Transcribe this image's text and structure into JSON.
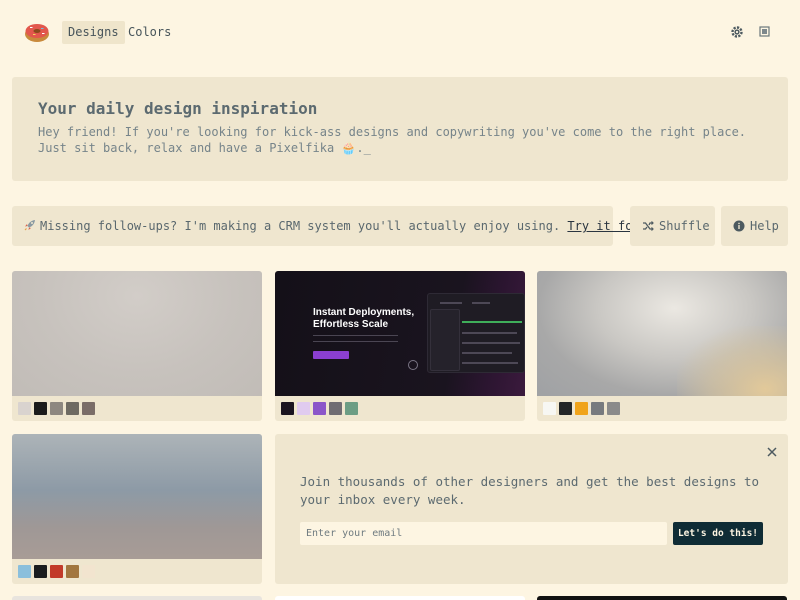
{
  "header": {
    "nav": [
      {
        "label": "Designs",
        "active": true
      },
      {
        "label": "Colors",
        "active": false
      }
    ],
    "icons": [
      "donut-logo",
      "settings-icon",
      "theme-square-icon"
    ]
  },
  "hero": {
    "title": "Your daily design inspiration",
    "text": "Hey friend! If you're looking for kick-ass designs and copywriting you've come to the right place. Just sit back, relax and have a Pixelfika 🧁._"
  },
  "promo": {
    "text": "Missing follow-ups? I'm making a CRM system you'll actually enjoy using.",
    "link": "Try it for free",
    "suffix": "."
  },
  "actions": {
    "shuffle": "Shuffle",
    "help": "Help"
  },
  "cards": [
    {
      "swatches": [
        "#d9d3cf",
        "#1b1b1b",
        "#8d8780",
        "#6e6a62",
        "#7a6d68"
      ]
    },
    {
      "title": "Instant Deployments, Effortless Scale",
      "swatches": [
        "#1a1420",
        "#e0cbef",
        "#8b56c9",
        "#6f6c72",
        "#6c9d84"
      ]
    },
    {
      "swatches": [
        "#f7f7f3",
        "#232628",
        "#f0a31a",
        "#777a7e",
        "#8a8a8a"
      ]
    },
    {
      "swatches": [
        "#8bbfdc",
        "#1a1c1e",
        "#c23a2a",
        "#a2763f",
        "#f2e4cf"
      ]
    }
  ],
  "newsletter": {
    "text": "Join thousands of other designers and get the best designs to your inbox every week.",
    "placeholder": "Enter your email",
    "button": "Let's do this!"
  }
}
